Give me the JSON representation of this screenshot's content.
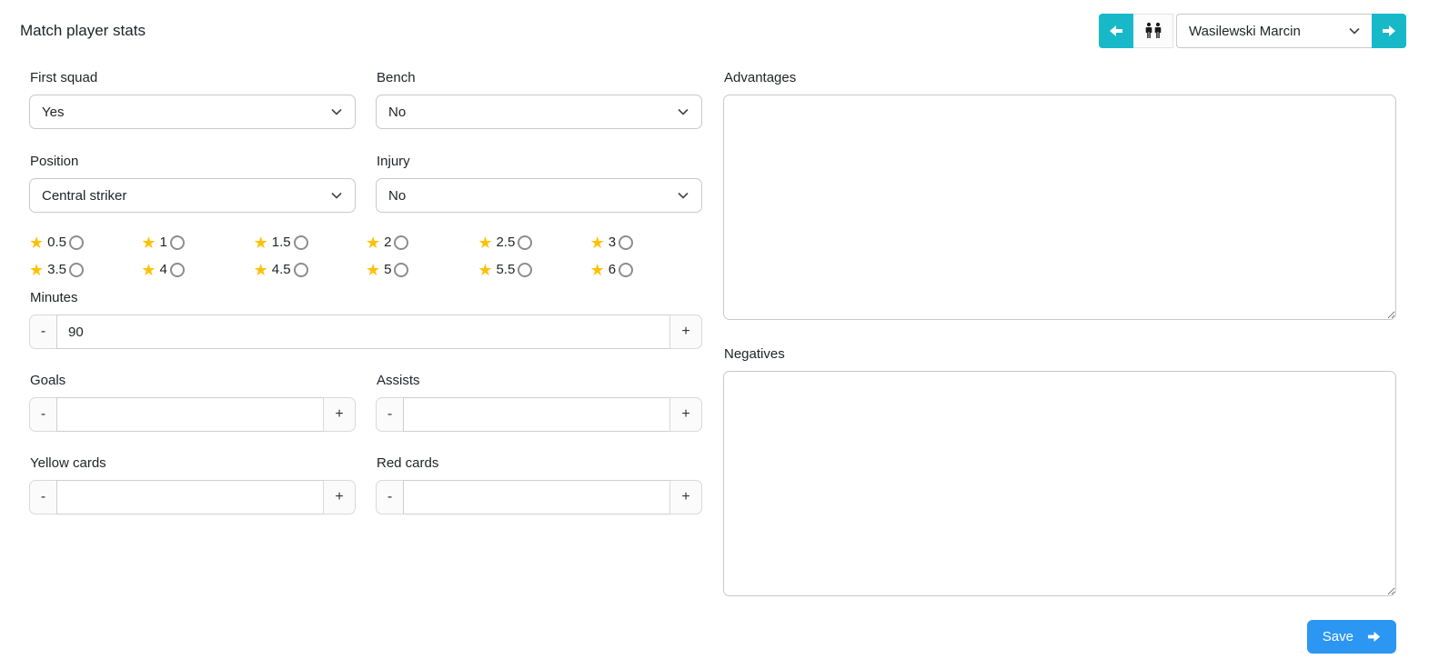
{
  "page": {
    "title": "Match player stats"
  },
  "header": {
    "player_select_value": "Wasilewski Marcin"
  },
  "form": {
    "first_squad": {
      "label": "First squad",
      "value": "Yes"
    },
    "bench": {
      "label": "Bench",
      "value": "No"
    },
    "position": {
      "label": "Position",
      "value": "Central striker"
    },
    "injury": {
      "label": "Injury",
      "value": "No"
    },
    "rating_options": [
      "0.5",
      "1",
      "1.5",
      "2",
      "2.5",
      "3",
      "3.5",
      "4",
      "4.5",
      "5",
      "5.5",
      "6"
    ],
    "rating_selected": "",
    "minutes": {
      "label": "Minutes",
      "value": "90"
    },
    "goals": {
      "label": "Goals",
      "value": ""
    },
    "assists": {
      "label": "Assists",
      "value": ""
    },
    "yellow_cards": {
      "label": "Yellow cards",
      "value": ""
    },
    "red_cards": {
      "label": "Red cards",
      "value": ""
    },
    "advantages": {
      "label": "Advantages",
      "value": ""
    },
    "negatives": {
      "label": "Negatives",
      "value": ""
    },
    "stepper": {
      "minus": "-",
      "plus": "+"
    }
  },
  "actions": {
    "save_label": "Save"
  },
  "colors": {
    "accent_teal": "#17b9c9",
    "accent_blue": "#2b97f3",
    "star_yellow": "#ffc107"
  }
}
